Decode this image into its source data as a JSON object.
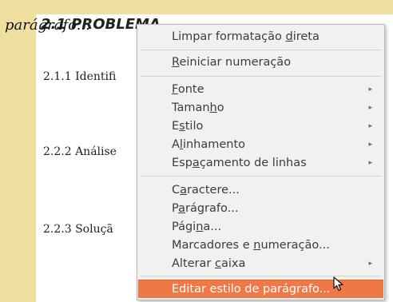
{
  "document": {
    "heading": "2.1 PROBLEMA",
    "floating_label": "parágrafo...",
    "lines": [
      "2.1.1 Identifi",
      "2.2.2 Análise",
      "2.2.3 Soluçã"
    ]
  },
  "context_menu": {
    "items": [
      {
        "pre": "Limpar formatação ",
        "acc": "d",
        "post": "ireta"
      },
      {
        "pre": "",
        "acc": "R",
        "post": "einiciar numeração"
      },
      {
        "pre": "",
        "acc": "F",
        "post": "onte"
      },
      {
        "pre": "Taman",
        "acc": "h",
        "post": "o"
      },
      {
        "pre": "E",
        "acc": "s",
        "post": "tilo"
      },
      {
        "pre": "A",
        "acc": "l",
        "post": "inhamento"
      },
      {
        "pre": "Esp",
        "acc": "a",
        "post": "çamento de linhas"
      },
      {
        "pre": "C",
        "acc": "a",
        "post": "ractere..."
      },
      {
        "pre": "P",
        "acc": "a",
        "post": "rágrafo..."
      },
      {
        "pre": "Pági",
        "acc": "n",
        "post": "a..."
      },
      {
        "pre": "Marcadores e ",
        "acc": "n",
        "post": "umeração..."
      },
      {
        "pre": "Alterar ",
        "acc": "c",
        "post": "aixa"
      },
      {
        "pre": "Editar estilo de parágrafo...",
        "acc": "",
        "post": ""
      }
    ],
    "submenu_arrow": "▸"
  }
}
